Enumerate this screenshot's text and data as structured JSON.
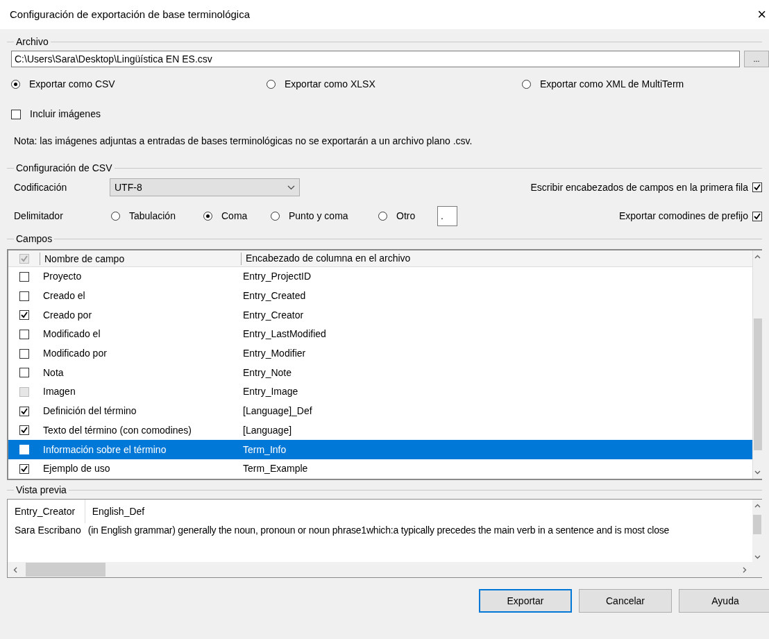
{
  "window": {
    "title": "Configuración de exportación de base terminológica",
    "close": "×"
  },
  "archivo": {
    "legend": "Archivo",
    "path": "C:\\Users\\Sara\\Desktop\\Lingüística EN ES.csv",
    "browse": "...",
    "formats": [
      {
        "label": "Exportar como CSV",
        "selected": true
      },
      {
        "label": "Exportar como XLSX",
        "selected": false
      },
      {
        "label": "Exportar como XML de MultiTerm",
        "selected": false
      }
    ],
    "include_images": {
      "label": "Incluir imágenes",
      "checked": false
    },
    "note": "Nota: las imágenes adjuntas a entradas de bases terminológicas no se exportarán a un archivo plano .csv."
  },
  "csv": {
    "legend": "Configuración de CSV",
    "encoding_label": "Codificación",
    "encoding": "UTF-8",
    "delimiter_label": "Delimitador",
    "delimiters": [
      {
        "label": "Tabulación",
        "selected": false
      },
      {
        "label": "Coma",
        "selected": true
      },
      {
        "label": "Punto y coma",
        "selected": false
      },
      {
        "label": "Otro",
        "selected": false
      }
    ],
    "other_value": ".",
    "options": [
      {
        "label": "Escribir encabezados de campos en la primera fila",
        "checked": true
      },
      {
        "label": "Exportar comodines de prefijo",
        "checked": true
      }
    ]
  },
  "fields": {
    "legend": "Campos",
    "header_checked": true,
    "columns": [
      "Nombre de campo",
      "Encabezado de columna en el archivo"
    ],
    "rows": [
      {
        "name": "Proyecto",
        "column": "Entry_ProjectID",
        "checked": false,
        "disabled": false,
        "selected": false
      },
      {
        "name": "Creado el",
        "column": "Entry_Created",
        "checked": false,
        "disabled": false,
        "selected": false
      },
      {
        "name": "Creado por",
        "column": "Entry_Creator",
        "checked": true,
        "disabled": false,
        "selected": false
      },
      {
        "name": "Modificado el",
        "column": "Entry_LastModified",
        "checked": false,
        "disabled": false,
        "selected": false
      },
      {
        "name": "Modificado por",
        "column": "Entry_Modifier",
        "checked": false,
        "disabled": false,
        "selected": false
      },
      {
        "name": "Nota",
        "column": "Entry_Note",
        "checked": false,
        "disabled": false,
        "selected": false
      },
      {
        "name": "Imagen",
        "column": "Entry_Image",
        "checked": false,
        "disabled": true,
        "selected": false
      },
      {
        "name": "Definición del término",
        "column": "[Language]_Def",
        "checked": true,
        "disabled": false,
        "selected": false
      },
      {
        "name": "Texto del término (con comodines)",
        "column": "[Language]",
        "checked": true,
        "disabled": false,
        "selected": false
      },
      {
        "name": "Información sobre el término",
        "column": "Term_Info",
        "checked": false,
        "disabled": false,
        "selected": true
      },
      {
        "name": "Ejemplo de uso",
        "column": "Term_Example",
        "checked": true,
        "disabled": false,
        "selected": false
      }
    ]
  },
  "preview": {
    "legend": "Vista previa",
    "columns": [
      "Entry_Creator",
      "English_Def"
    ],
    "rows": [
      [
        "Sara Escribano",
        "(in English grammar) generally the noun, pronoun or noun phrase1which:a typically precedes the main verb in a sentence and is most close"
      ]
    ]
  },
  "buttons": [
    "Exportar",
    "Cancelar",
    "Ayuda"
  ]
}
